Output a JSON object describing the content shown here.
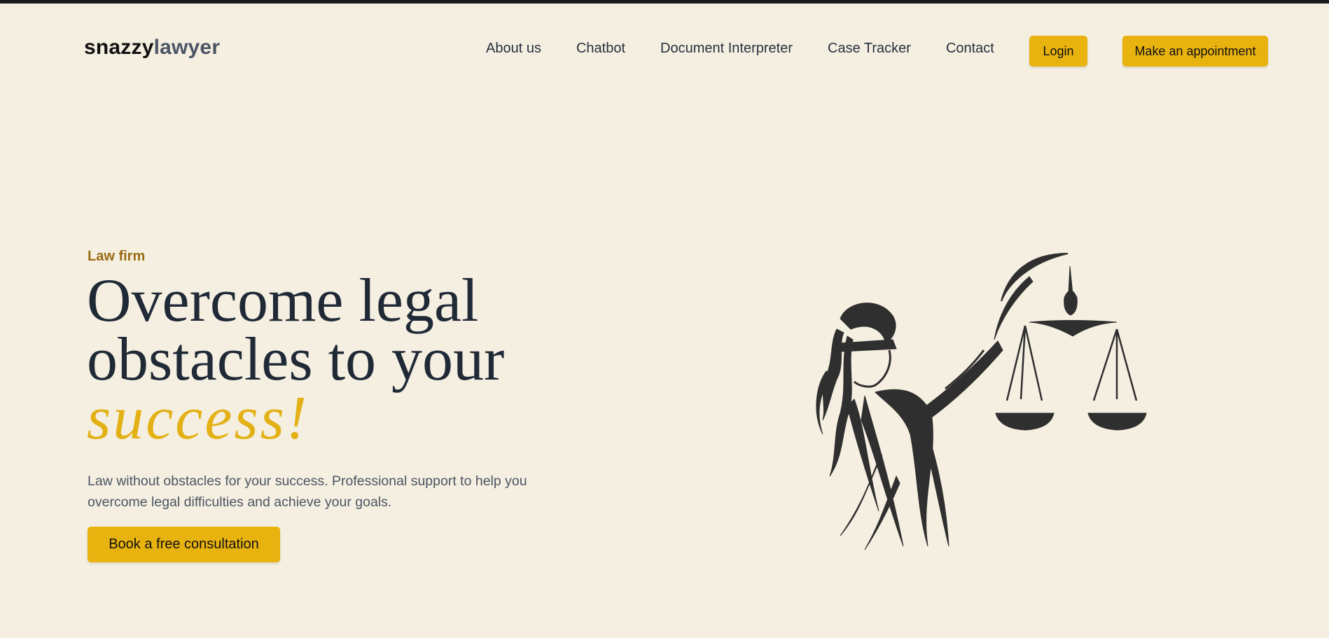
{
  "brand": {
    "part1": "snazzy",
    "part2": "lawyer"
  },
  "nav": {
    "items": [
      "About us",
      "Chatbot",
      "Document Interpreter",
      "Case Tracker",
      "Contact"
    ],
    "login_label": "Login",
    "appointment_label": "Make an appointment"
  },
  "hero": {
    "eyebrow": "Law firm",
    "headline_line1": "Overcome legal",
    "headline_line2": "obstacles to your",
    "headline_accent": "success!",
    "description": "Law without obstacles for your success. Professional support to help you overcome legal difficulties and achieve your goals.",
    "cta_label": "Book a free consultation"
  },
  "colors": {
    "background": "#f5efe1",
    "accent": "#e8b20f",
    "eyebrow": "#9a6b14",
    "heading": "#202a37",
    "illustration": "#2f2f2f"
  },
  "icons": {
    "hero_art": "lady-justice-illustration"
  }
}
